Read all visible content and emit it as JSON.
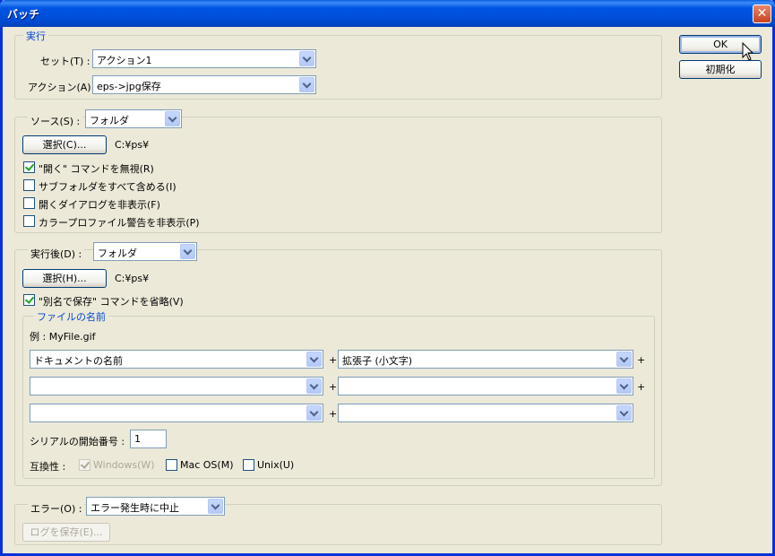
{
  "window": {
    "title": "バッチ",
    "close_glyph": "✕"
  },
  "buttons": {
    "ok": "OK",
    "reset": "初期化"
  },
  "play": {
    "legend": "実行",
    "set_label": "セット(T) :",
    "set_value": "アクション1",
    "action_label": "アクション(A) :",
    "action_value": "eps->jpg保存"
  },
  "source": {
    "label": "ソース(S) :",
    "value": "フォルダ",
    "choose_button": "選択(C)...",
    "path": "C:¥ps¥",
    "options": [
      {
        "label": "\"開く\" コマンドを無視(R)",
        "checked": true
      },
      {
        "label": "サブフォルダをすべて含める(I)",
        "checked": false
      },
      {
        "label": "開くダイアログを非表示(F)",
        "checked": false
      },
      {
        "label": "カラープロファイル警告を非表示(P)",
        "checked": false
      }
    ]
  },
  "destination": {
    "label": "実行後(D) :",
    "value": "フォルダ",
    "choose_button": "選択(H)...",
    "path": "C:¥ps¥",
    "override_label": "\"別名で保存\" コマンドを省略(V)",
    "override_checked": true
  },
  "file_naming": {
    "legend": "ファイルの名前",
    "example": "例 : MyFile.gif",
    "rows": [
      [
        "ドキュメントの名前",
        "拡張子 (小文字)"
      ],
      [
        "",
        ""
      ],
      [
        "",
        ""
      ]
    ],
    "plus": "+",
    "serial_label": "シリアルの開始番号 :",
    "serial_value": "1",
    "compat_label": "互換性 :",
    "compat": [
      {
        "label": "Windows(W)",
        "checked": true,
        "disabled": true
      },
      {
        "label": "Mac OS(M)",
        "checked": false,
        "disabled": false
      },
      {
        "label": "Unix(U)",
        "checked": false,
        "disabled": false
      }
    ]
  },
  "errors": {
    "label": "エラー(O) :",
    "value": "エラー発生時に中止",
    "save_log_button": "ログを保存(E)..."
  }
}
